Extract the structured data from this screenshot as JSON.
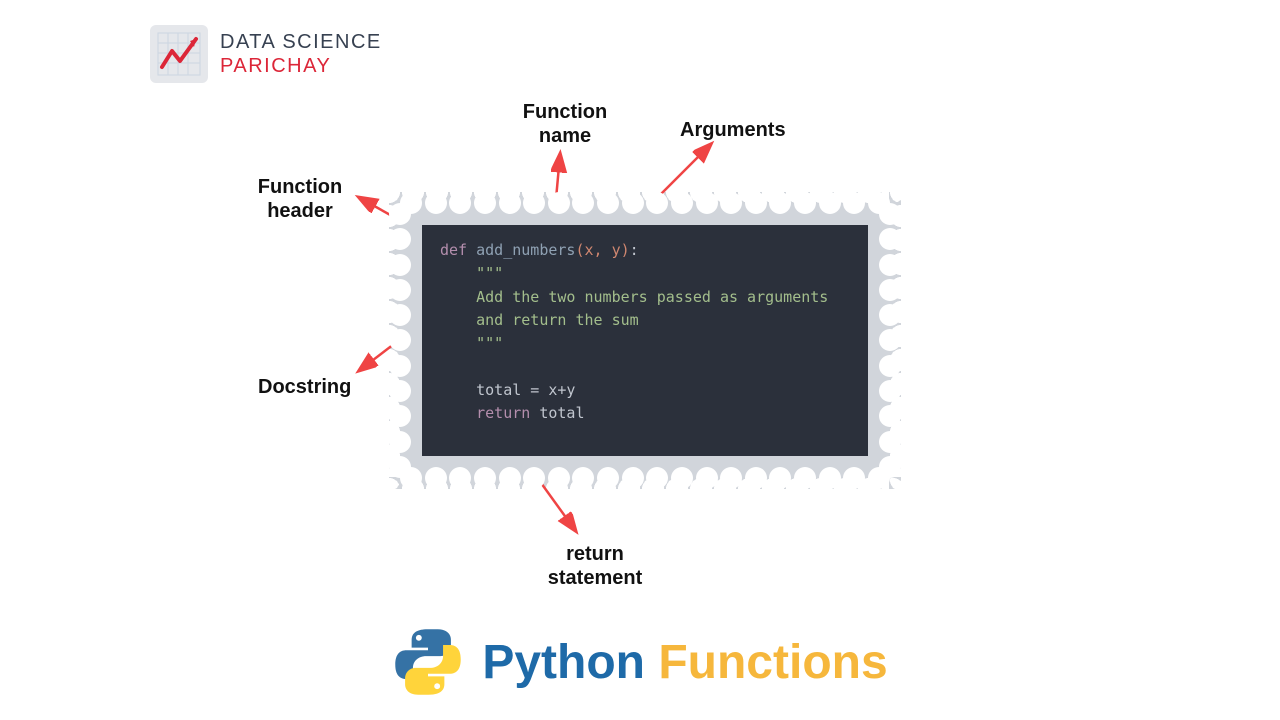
{
  "logo": {
    "line1": "DATA SCIENCE",
    "line2": "PARICHAY"
  },
  "labels": {
    "function_name": "Function\nname",
    "arguments": "Arguments",
    "function_header": "Function\nheader",
    "docstring": "Docstring",
    "return_statement": "return\nstatement"
  },
  "code": {
    "keyword_def": "def",
    "func_name": "add_numbers",
    "params": "(x, y)",
    "colon": ":",
    "triple_quote": "\"\"\"",
    "doc_line1": "Add the two numbers passed as arguments",
    "doc_line2": "and return the sum",
    "assign_line": "total = x+y",
    "keyword_return": "return",
    "return_var": "total"
  },
  "title": {
    "word1": "Python",
    "word2": "Functions"
  },
  "colors": {
    "arrow": "#ef4444",
    "code_bg": "#2b303b",
    "stamp_bg": "#d1d5db",
    "title_blue": "#1e6aa8",
    "title_yellow": "#f6b73c",
    "logo_red": "#dc2638"
  }
}
